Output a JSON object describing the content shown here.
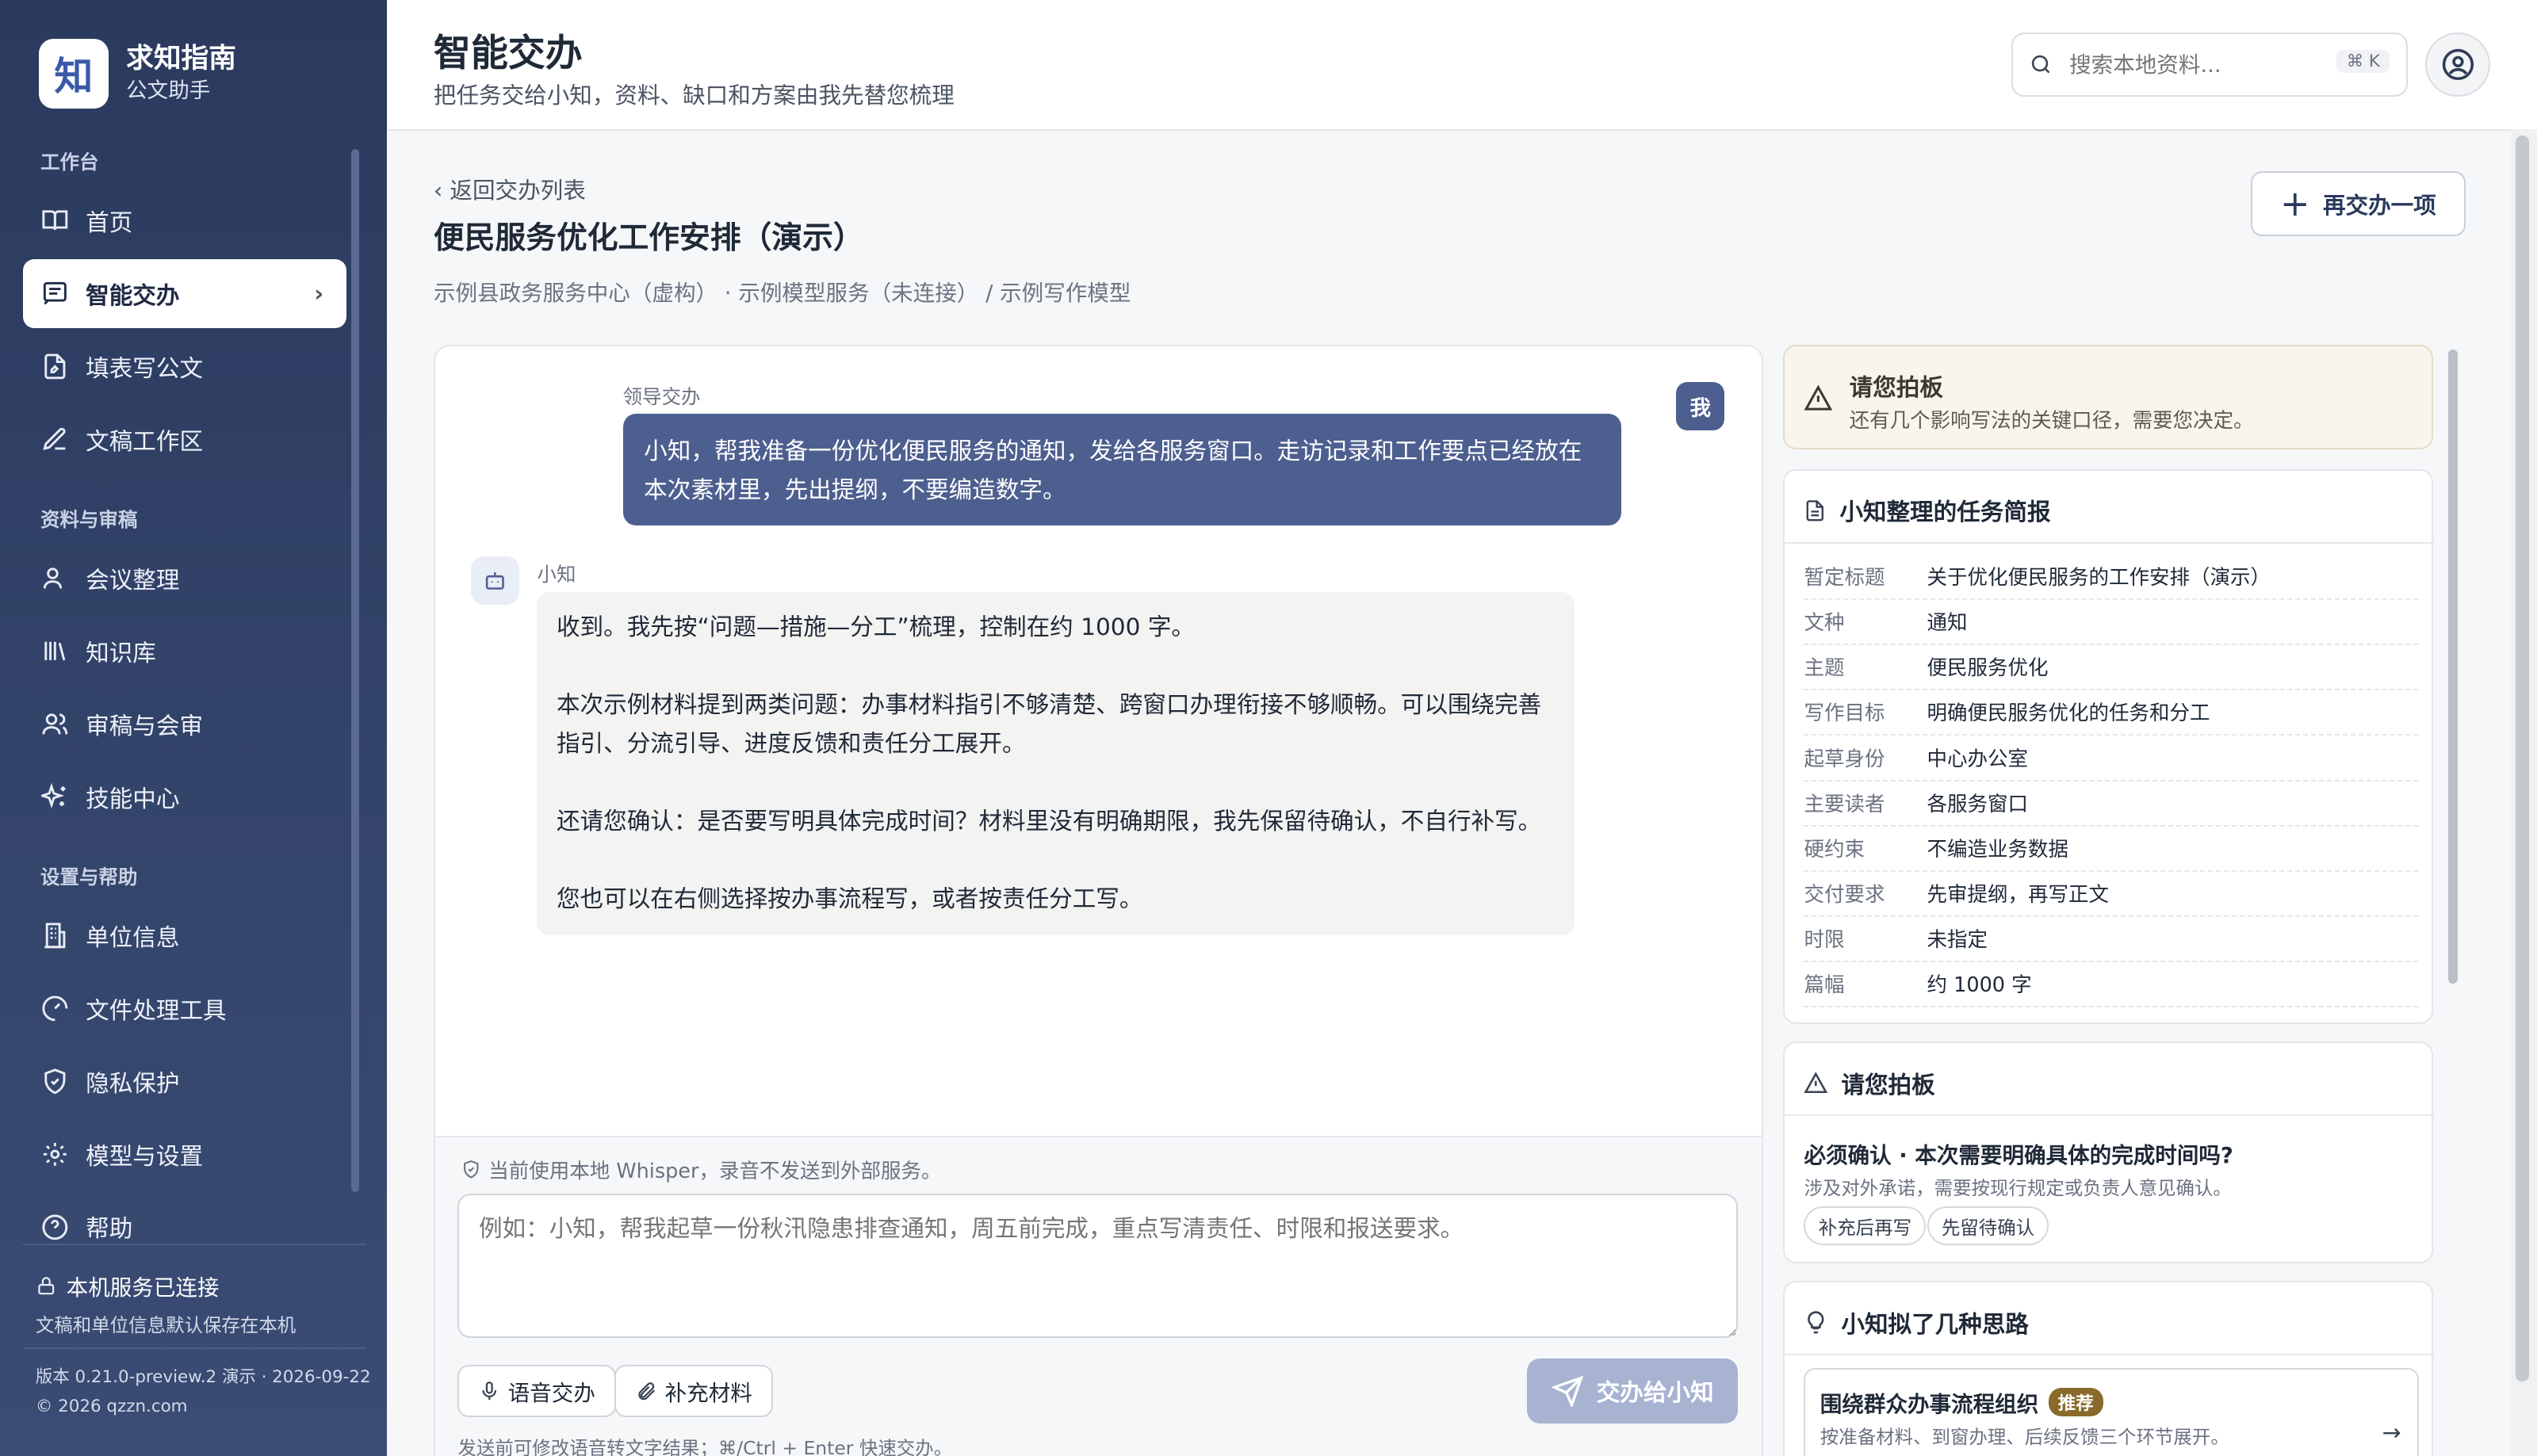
{
  "brand": {
    "logo": "知",
    "name": "求知指南",
    "sub": "公文助手"
  },
  "nav": {
    "sections": [
      "工作台",
      "资料与审稿",
      "设置与帮助"
    ],
    "items": [
      {
        "label": "首页",
        "icon": "book-icon"
      },
      {
        "label": "智能交办",
        "icon": "message-icon",
        "active": true
      },
      {
        "label": "填表写公文",
        "icon": "file-edit-icon"
      },
      {
        "label": "文稿工作区",
        "icon": "pen-icon"
      },
      {
        "label": "会议整理",
        "icon": "user-icon"
      },
      {
        "label": "知识库",
        "icon": "library-icon"
      },
      {
        "label": "审稿与会审",
        "icon": "users-icon"
      },
      {
        "label": "技能中心",
        "icon": "sparkle-icon"
      },
      {
        "label": "单位信息",
        "icon": "building-icon"
      },
      {
        "label": "文件处理工具",
        "icon": "gauge-icon"
      },
      {
        "label": "隐私保护",
        "icon": "shield-icon"
      },
      {
        "label": "模型与设置",
        "icon": "gear-icon"
      },
      {
        "label": "帮助",
        "icon": "help-icon"
      }
    ]
  },
  "footer": {
    "status": "本机服务已连接",
    "status_sub": "文稿和单位信息默认保存在本机",
    "version": "版本 0.21.0-preview.2 演示 · 2026-09-22",
    "copyright": "© 2026 qzzn.com"
  },
  "header": {
    "title": "智能交办",
    "subtitle": "把任务交给小知，资料、缺口和方案由我先替您梳理",
    "search_placeholder": "搜索本地资料...",
    "search_kbd": "⌘ K"
  },
  "task": {
    "back": "‹ 返回交办列表",
    "title": "便民服务优化工作安排（演示）",
    "meta": "示例县政务服务中心（虚构） · 示例模型服务（未连接） / 示例写作模型",
    "again_label": "再交办一项"
  },
  "chat": {
    "me_label": "领导交办",
    "me_avatar": "我",
    "me_text": "小知，帮我准备一份优化便民服务的通知，发给各服务窗口。走访记录和工作要点已经放在本次素材里，先出提纲，不要编造数字。",
    "bot_label": "小知",
    "bot_paragraphs": [
      "收到。我先按“问题—措施—分工”梳理，控制在约 1000 字。",
      "本次示例材料提到两类问题：办事材料指引不够清楚、跨窗口办理衔接不够顺畅。可以围绕完善指引、分流引导、进度反馈和责任分工展开。",
      "还请您确认：是否要写明具体完成时间？材料里没有明确期限，我先保留待确认，不自行补写。",
      "您也可以在右侧选择按办事流程写，或者按责任分工写。"
    ]
  },
  "composer": {
    "whisper": "当前使用本地 Whisper，录音不发送到外部服务。",
    "placeholder": "例如：小知，帮我起草一份秋汛隐患排查通知，周五前完成，重点写清责任、时限和报送要求。",
    "voice": "语音交办",
    "attach": "补充材料",
    "send": "交办给小知",
    "hint": "发送前可修改语音转文字结果；⌘/Ctrl + Enter 快速交办。"
  },
  "alert": {
    "title": "请您拍板",
    "sub": "还有几个影响写法的关键口径，需要您决定。"
  },
  "brief": {
    "title": "小知整理的任务简报",
    "rows": [
      {
        "k": "暂定标题",
        "v": "关于优化便民服务的工作安排（演示）"
      },
      {
        "k": "文种",
        "v": "通知"
      },
      {
        "k": "主题",
        "v": "便民服务优化"
      },
      {
        "k": "写作目标",
        "v": "明确便民服务优化的任务和分工"
      },
      {
        "k": "起草身份",
        "v": "中心办公室"
      },
      {
        "k": "主要读者",
        "v": "各服务窗口"
      },
      {
        "k": "硬约束",
        "v": "不编造业务数据"
      },
      {
        "k": "交付要求",
        "v": "先审提纲，再写正文"
      },
      {
        "k": "时限",
        "v": "未指定"
      },
      {
        "k": "篇幅",
        "v": "约 1000 字"
      }
    ]
  },
  "decide": {
    "title": "请您拍板",
    "question": "必须确认 · 本次需要明确具体的完成时间吗?",
    "question_sub": "涉及对外承诺，需要按现行规定或负责人意见确认。",
    "options": [
      "补充后再写",
      "先留待确认"
    ]
  },
  "ideas": {
    "title": "小知拟了几种思路",
    "items": [
      {
        "title": "围绕群众办事流程组织",
        "badge": "推荐",
        "sub": "按准备材料、到窗办理、后续反馈三个环节展开。"
      }
    ]
  }
}
